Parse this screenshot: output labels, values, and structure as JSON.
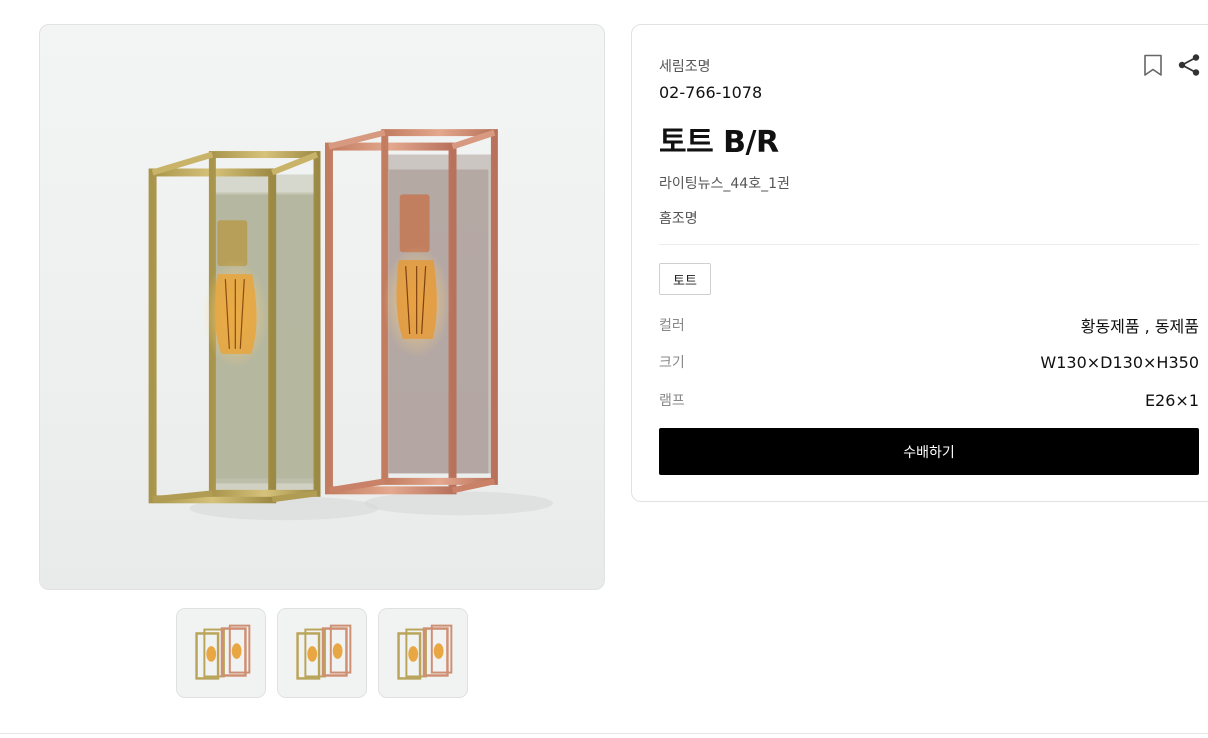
{
  "product": {
    "brand": "세림조명",
    "phone": "02-766-1078",
    "title": "토트 B/R",
    "issue": "라이팅뉴스_44호_1권",
    "category": "홈조명",
    "tag": "토트"
  },
  "specs": {
    "color": {
      "label": "컬러",
      "value": "황동제품 , 동제품"
    },
    "size": {
      "label": "크기",
      "value": "W130×D130×H350"
    },
    "lamp": {
      "label": "램프",
      "value": "E26×1"
    }
  },
  "actions": {
    "order_label": "수배하기",
    "bookmark_icon": "bookmark-icon",
    "share_icon": "share-icon"
  },
  "gallery": {
    "thumbnail_count": 3,
    "brass_color": "#b9a55a",
    "copper_color": "#cf8f72"
  }
}
